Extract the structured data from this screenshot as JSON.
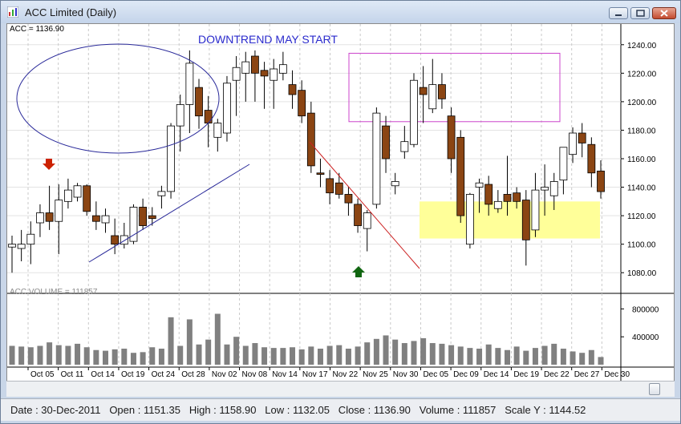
{
  "window": {
    "title": "ACC Limited (Daily)",
    "controls": [
      "minimize-icon",
      "maximize-icon",
      "close-icon"
    ]
  },
  "price_panel_label": "ACC = 1136.90",
  "volume_panel_label": "ACC VOLUME = 111857",
  "annotation_text": "DOWNTREND MAY START",
  "status": {
    "text": "Date : 30-Dec-2011   Open : 1151.35   High : 1158.90   Low : 1132.05   Close : 1136.90   Volume : 111857   Scale Y : 1144.52"
  },
  "colors": {
    "bullish": "#ffffff",
    "bearish": "#8b4513",
    "volume_bar": "#808080",
    "ellipse": "#2a2a9a",
    "trendline_up": "#2a2a9a",
    "trendline_down": "#cc2222",
    "magenta_box": "#cc44cc",
    "support_zone": "#ffff99",
    "arrow_down": "#cc2200",
    "arrow_up": "#116611"
  },
  "chart_data": {
    "type": "candlestick",
    "price_axis": {
      "ylim": [
        1070,
        1250
      ],
      "ticks": [
        "1240.00",
        "1220.00",
        "1200.00",
        "1180.00",
        "1160.00",
        "1140.00",
        "1120.00",
        "1100.00",
        "1080.00"
      ]
    },
    "volume_axis": {
      "ylim": [
        0,
        1000000
      ],
      "ticks": [
        "800000",
        "400000"
      ]
    },
    "x_labels": [
      "Oct 05",
      "Oct 11",
      "Oct 14",
      "Oct 19",
      "Oct 24",
      "Oct 28",
      "Nov 02",
      "Nov 08",
      "Nov 14",
      "Nov 17",
      "Nov 22",
      "Nov 25",
      "Nov 30",
      "Dec 05",
      "Dec 09",
      "Dec 14",
      "Dec 19",
      "Dec 22",
      "Dec 27",
      "Dec 30"
    ],
    "candles": [
      {
        "o": 1098,
        "h": 1106,
        "l": 1080,
        "c": 1100
      },
      {
        "o": 1097,
        "h": 1110,
        "l": 1088,
        "c": 1100
      },
      {
        "o": 1100,
        "h": 1116,
        "l": 1086,
        "c": 1107
      },
      {
        "o": 1115,
        "h": 1128,
        "l": 1105,
        "c": 1122
      },
      {
        "o": 1122,
        "h": 1141,
        "l": 1110,
        "c": 1116
      },
      {
        "o": 1116,
        "h": 1142,
        "l": 1093,
        "c": 1131
      },
      {
        "o": 1130,
        "h": 1146,
        "l": 1125,
        "c": 1138
      },
      {
        "o": 1133,
        "h": 1143,
        "l": 1130,
        "c": 1141
      },
      {
        "o": 1141,
        "h": 1142,
        "l": 1120,
        "c": 1123
      },
      {
        "o": 1120,
        "h": 1130,
        "l": 1110,
        "c": 1116
      },
      {
        "o": 1115,
        "h": 1125,
        "l": 1108,
        "c": 1120
      },
      {
        "o": 1106,
        "h": 1118,
        "l": 1093,
        "c": 1100
      },
      {
        "o": 1100,
        "h": 1115,
        "l": 1097,
        "c": 1106
      },
      {
        "o": 1102,
        "h": 1128,
        "l": 1100,
        "c": 1126
      },
      {
        "o": 1126,
        "h": 1132,
        "l": 1110,
        "c": 1113
      },
      {
        "o": 1120,
        "h": 1126,
        "l": 1113,
        "c": 1118
      },
      {
        "o": 1134,
        "h": 1141,
        "l": 1125,
        "c": 1137
      },
      {
        "o": 1137,
        "h": 1185,
        "l": 1132,
        "c": 1183
      },
      {
        "o": 1183,
        "h": 1205,
        "l": 1165,
        "c": 1198
      },
      {
        "o": 1198,
        "h": 1236,
        "l": 1178,
        "c": 1227
      },
      {
        "o": 1210,
        "h": 1216,
        "l": 1181,
        "c": 1190
      },
      {
        "o": 1194,
        "h": 1204,
        "l": 1168,
        "c": 1185
      },
      {
        "o": 1175,
        "h": 1188,
        "l": 1165,
        "c": 1185
      },
      {
        "o": 1178,
        "h": 1218,
        "l": 1172,
        "c": 1213
      },
      {
        "o": 1215,
        "h": 1232,
        "l": 1190,
        "c": 1224
      },
      {
        "o": 1220,
        "h": 1235,
        "l": 1200,
        "c": 1228
      },
      {
        "o": 1232,
        "h": 1236,
        "l": 1200,
        "c": 1220
      },
      {
        "o": 1222,
        "h": 1228,
        "l": 1195,
        "c": 1218
      },
      {
        "o": 1215,
        "h": 1230,
        "l": 1195,
        "c": 1223
      },
      {
        "o": 1220,
        "h": 1235,
        "l": 1215,
        "c": 1226
      },
      {
        "o": 1212,
        "h": 1222,
        "l": 1195,
        "c": 1205
      },
      {
        "o": 1208,
        "h": 1215,
        "l": 1185,
        "c": 1190
      },
      {
        "o": 1192,
        "h": 1200,
        "l": 1150,
        "c": 1155
      },
      {
        "o": 1150,
        "h": 1160,
        "l": 1140,
        "c": 1149
      },
      {
        "o": 1146,
        "h": 1152,
        "l": 1128,
        "c": 1136
      },
      {
        "o": 1143,
        "h": 1150,
        "l": 1132,
        "c": 1135
      },
      {
        "o": 1135,
        "h": 1140,
        "l": 1120,
        "c": 1129
      },
      {
        "o": 1128,
        "h": 1132,
        "l": 1108,
        "c": 1113
      },
      {
        "o": 1111,
        "h": 1124,
        "l": 1095,
        "c": 1122
      },
      {
        "o": 1128,
        "h": 1196,
        "l": 1125,
        "c": 1192
      },
      {
        "o": 1183,
        "h": 1190,
        "l": 1150,
        "c": 1160
      },
      {
        "o": 1141,
        "h": 1150,
        "l": 1135,
        "c": 1144
      },
      {
        "o": 1165,
        "h": 1183,
        "l": 1160,
        "c": 1172
      },
      {
        "o": 1170,
        "h": 1220,
        "l": 1168,
        "c": 1215
      },
      {
        "o": 1210,
        "h": 1225,
        "l": 1185,
        "c": 1205
      },
      {
        "o": 1195,
        "h": 1230,
        "l": 1192,
        "c": 1212
      },
      {
        "o": 1212,
        "h": 1220,
        "l": 1195,
        "c": 1202
      },
      {
        "o": 1190,
        "h": 1196,
        "l": 1150,
        "c": 1160
      },
      {
        "o": 1175,
        "h": 1180,
        "l": 1115,
        "c": 1120
      },
      {
        "o": 1100,
        "h": 1136,
        "l": 1097,
        "c": 1135
      },
      {
        "o": 1140,
        "h": 1146,
        "l": 1122,
        "c": 1143
      },
      {
        "o": 1142,
        "h": 1148,
        "l": 1120,
        "c": 1128
      },
      {
        "o": 1125,
        "h": 1138,
        "l": 1122,
        "c": 1130
      },
      {
        "o": 1135,
        "h": 1162,
        "l": 1120,
        "c": 1130
      },
      {
        "o": 1136,
        "h": 1140,
        "l": 1125,
        "c": 1130
      },
      {
        "o": 1131,
        "h": 1138,
        "l": 1085,
        "c": 1103
      },
      {
        "o": 1110,
        "h": 1150,
        "l": 1105,
        "c": 1138
      },
      {
        "o": 1138,
        "h": 1156,
        "l": 1120,
        "c": 1140
      },
      {
        "o": 1134,
        "h": 1150,
        "l": 1124,
        "c": 1144
      },
      {
        "o": 1145,
        "h": 1165,
        "l": 1135,
        "c": 1168
      },
      {
        "o": 1163,
        "h": 1182,
        "l": 1157,
        "c": 1178
      },
      {
        "o": 1178,
        "h": 1185,
        "l": 1161,
        "c": 1171
      },
      {
        "o": 1170,
        "h": 1175,
        "l": 1140,
        "c": 1150
      },
      {
        "o": 1151.35,
        "h": 1158.9,
        "l": 1132.05,
        "c": 1136.9
      }
    ],
    "volume": [
      270000,
      260000,
      250000,
      270000,
      320000,
      280000,
      270000,
      300000,
      250000,
      210000,
      200000,
      220000,
      230000,
      170000,
      180000,
      250000,
      230000,
      680000,
      270000,
      650000,
      290000,
      360000,
      730000,
      290000,
      400000,
      270000,
      310000,
      250000,
      240000,
      240000,
      250000,
      220000,
      260000,
      230000,
      270000,
      280000,
      230000,
      260000,
      320000,
      370000,
      420000,
      360000,
      310000,
      340000,
      380000,
      310000,
      300000,
      280000,
      260000,
      240000,
      230000,
      290000,
      240000,
      210000,
      260000,
      200000,
      240000,
      270000,
      300000,
      230000,
      190000,
      170000,
      210000,
      110000
    ]
  }
}
